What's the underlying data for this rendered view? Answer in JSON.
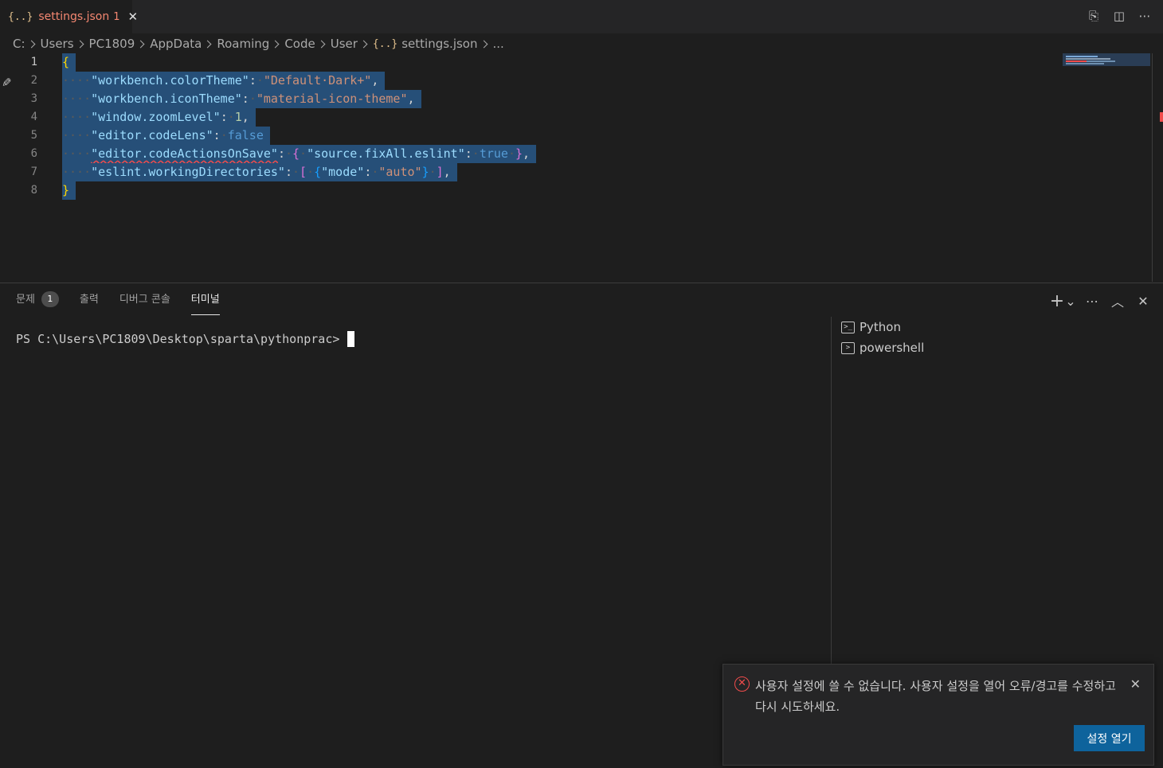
{
  "tab": {
    "file_icon": "{..}",
    "name": "settings.json",
    "problem_count": "1",
    "close_glyph": "✕"
  },
  "tab_actions": [
    {
      "name": "open-changes-icon",
      "glyph": "⎘"
    },
    {
      "name": "split-editor-icon",
      "glyph": "◫"
    },
    {
      "name": "more-actions-icon",
      "glyph": "⋯"
    }
  ],
  "breadcrumb": {
    "segments": [
      "C:",
      "Users",
      "PC1809",
      "AppData",
      "Roaming",
      "Code",
      "User"
    ],
    "file_icon": "{..}",
    "file": "settings.json",
    "tail": "..."
  },
  "editor": {
    "line_numbers": [
      "1",
      "2",
      "3",
      "4",
      "5",
      "6",
      "7",
      "8"
    ],
    "lines": {
      "l1": {
        "open": "{"
      },
      "l2": {
        "ws": "····",
        "key": "\"workbench.colorTheme\"",
        "colon": ":",
        "ws2": "·",
        "value": "\"Default·Dark+\"",
        "comma": ","
      },
      "l3": {
        "ws": "····",
        "key": "\"workbench.iconTheme\"",
        "colon": ":",
        "ws2": "·",
        "value": "\"material-icon-theme\"",
        "comma": ","
      },
      "l4": {
        "ws": "····",
        "key": "\"window.zoomLevel\"",
        "colon": ":",
        "ws2": "·",
        "value": "1",
        "comma": ","
      },
      "l5": {
        "ws": "····",
        "key": "\"editor.codeLens\"",
        "colon": ":",
        "ws2": "·",
        "value": "false"
      },
      "l6": {
        "ws": "····",
        "key": "\"editor.codeActionsOnSave\"",
        "colon": ":",
        "ws2": "·",
        "open": "{",
        "ws3": "·",
        "inner_key": "\"source.fixAll.eslint\"",
        "colon2": ":",
        "ws4": "·",
        "inner_value": "true",
        "ws5": "·",
        "close": "}",
        "comma": ","
      },
      "l7": {
        "ws": "····",
        "key": "\"eslint.workingDirectories\"",
        "colon": ":",
        "ws2": "·",
        "open_bracket": "[",
        "ws3": "·",
        "open": "{",
        "inner_key": "\"mode\"",
        "colon2": ":",
        "ws4": "·",
        "inner_value": "\"auto\"",
        "close": "}",
        "ws5": "·",
        "close_bracket": "]",
        "comma": ","
      },
      "l8": {
        "close": "}"
      }
    }
  },
  "panel": {
    "tabs": {
      "problems": "문제",
      "problems_count": "1",
      "output": "출력",
      "debug_console": "디버그 콘솔",
      "terminal": "터미널"
    },
    "actions": [
      {
        "name": "new-terminal-icon",
        "glyph": "+"
      },
      {
        "name": "chevron-down-icon",
        "glyph": "⌄"
      },
      {
        "name": "more-actions-icon",
        "glyph": "⋯"
      },
      {
        "name": "maximize-panel-icon",
        "glyph": "︿"
      },
      {
        "name": "close-panel-icon",
        "glyph": "✕"
      }
    ],
    "terminal_prompt": "PS C:\\Users\\PC1809\\Desktop\\sparta\\pythonprac>",
    "terminal_list": [
      "Python",
      "powershell"
    ]
  },
  "notification": {
    "message": "사용자 설정에 쓸 수 없습니다. 사용자 설정을 열어 오류/경고를 수정하고 다시 시도하세요.",
    "button_label": "설정 열기",
    "close_glyph": "✕",
    "error_glyph": "✕"
  },
  "colors": {
    "accent": "#0e639c",
    "error": "#f14c4c",
    "selection": "#264f78"
  }
}
